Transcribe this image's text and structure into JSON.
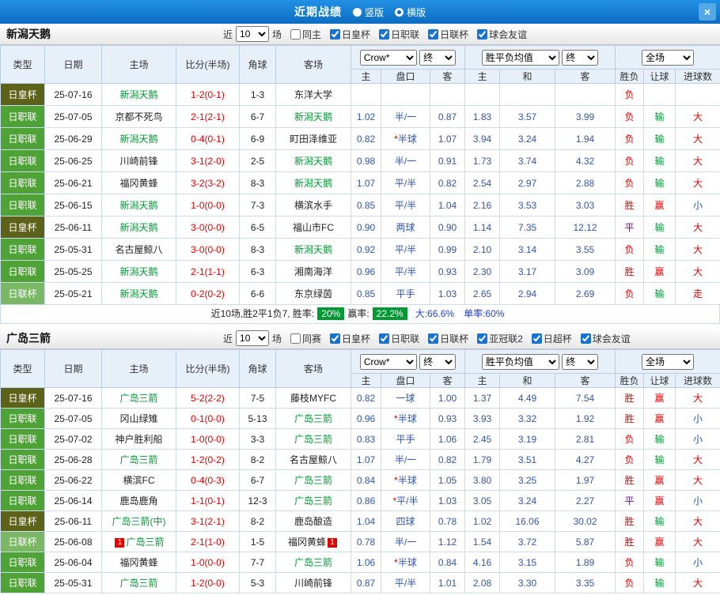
{
  "topbar": {
    "title": "近期战绩",
    "radios": [
      {
        "label": "竖版",
        "checked": false
      },
      {
        "label": "横版",
        "checked": true
      }
    ],
    "close_icon": "×"
  },
  "filter_common": {
    "near": "近",
    "count": "10",
    "games": "场"
  },
  "table_head": {
    "type": "类型",
    "date": "日期",
    "home": "主场",
    "score": "比分(半场)",
    "corner": "角球",
    "away": "客场",
    "company": "Crow*",
    "final": "终",
    "avg": "胜平负均值",
    "scope": "全场",
    "h": "主",
    "handicap": "盘口",
    "a": "客",
    "draw": "和",
    "result": "胜负",
    "let": "让球",
    "goals": "进球数"
  },
  "colors": {
    "topbar_blue": "#0c6cc1",
    "win_red": "#e60000",
    "lose_green": "#009933",
    "small_blue": "#1f4fd8",
    "draw_purple": "#8000a0",
    "odds_blue": "#3355aa",
    "focal_team_green": "#009933",
    "type_emperor_cup_bg": "#5c6319",
    "type_j1_league_bg": "#4fa236",
    "type_league_cup_bg": "#7ab865",
    "rate_badge_green": "#009933"
  },
  "sections": [
    {
      "team": "新潟天鹅",
      "filters": [
        {
          "label": "同主",
          "checked": false
        },
        {
          "label": "日皇杯",
          "checked": true
        },
        {
          "label": "日职联",
          "checked": true
        },
        {
          "label": "日联杯",
          "checked": true
        },
        {
          "label": "球会友谊",
          "checked": true
        }
      ],
      "rows": [
        {
          "type": "日皇杯",
          "tk": "cup",
          "date": "25-07-16",
          "home": "新潟天鹅",
          "hf": true,
          "score": "1-2(0-1)",
          "corner": "1-3",
          "away": "东洋大学",
          "af": false,
          "odds": [
            "",
            "",
            "",
            "",
            "",
            ""
          ],
          "star": false,
          "res": [
            [
              "负",
              "r"
            ],
            [
              "",
              ""
            ],
            [
              "",
              ""
            ]
          ]
        },
        {
          "type": "日职联",
          "tk": "lg",
          "date": "25-07-05",
          "home": "京都不死鸟",
          "hf": false,
          "score": "2-1(2-1)",
          "corner": "6-7",
          "away": "新潟天鹅",
          "af": true,
          "odds": [
            "1.02",
            "半/一",
            "0.87",
            "1.83",
            "3.57",
            "3.99"
          ],
          "star": false,
          "res": [
            [
              "负",
              "r"
            ],
            [
              "输",
              "g"
            ],
            [
              "大",
              "r"
            ]
          ]
        },
        {
          "type": "日职联",
          "tk": "lg",
          "date": "25-06-29",
          "home": "新潟天鹅",
          "hf": true,
          "score": "0-4(0-1)",
          "corner": "6-9",
          "away": "町田泽维亚",
          "af": false,
          "odds": [
            "0.82",
            "半球",
            "1.07",
            "3.94",
            "3.24",
            "1.94"
          ],
          "star": true,
          "res": [
            [
              "负",
              "r"
            ],
            [
              "输",
              "g"
            ],
            [
              "大",
              "r"
            ]
          ]
        },
        {
          "type": "日职联",
          "tk": "lg",
          "date": "25-06-25",
          "home": "川崎前锋",
          "hf": false,
          "score": "3-1(2-0)",
          "corner": "2-5",
          "away": "新潟天鹅",
          "af": true,
          "odds": [
            "0.98",
            "半/一",
            "0.91",
            "1.73",
            "3.74",
            "4.32"
          ],
          "star": false,
          "res": [
            [
              "负",
              "r"
            ],
            [
              "输",
              "g"
            ],
            [
              "大",
              "r"
            ]
          ]
        },
        {
          "type": "日职联",
          "tk": "lg",
          "date": "25-06-21",
          "home": "福冈黄蜂",
          "hf": false,
          "score": "3-2(3-2)",
          "corner": "8-3",
          "away": "新潟天鹅",
          "af": true,
          "odds": [
            "1.07",
            "平/半",
            "0.82",
            "2.54",
            "2.97",
            "2.88"
          ],
          "star": false,
          "res": [
            [
              "负",
              "r"
            ],
            [
              "输",
              "g"
            ],
            [
              "大",
              "r"
            ]
          ]
        },
        {
          "type": "日职联",
          "tk": "lg",
          "date": "25-06-15",
          "home": "新潟天鹅",
          "hf": true,
          "score": "1-0(0-0)",
          "corner": "7-3",
          "away": "横滨水手",
          "af": false,
          "odds": [
            "0.85",
            "平/半",
            "1.04",
            "2.16",
            "3.53",
            "3.03"
          ],
          "star": false,
          "res": [
            [
              "胜",
              "r"
            ],
            [
              "赢",
              "r"
            ],
            [
              "小",
              "b"
            ]
          ]
        },
        {
          "type": "日皇杯",
          "tk": "cup",
          "date": "25-06-11",
          "home": "新潟天鹅",
          "hf": true,
          "score": "3-0(0-0)",
          "corner": "6-5",
          "away": "福山市FC",
          "af": false,
          "odds": [
            "0.90",
            "两球",
            "0.90",
            "1.14",
            "7.35",
            "12.12"
          ],
          "star": false,
          "res": [
            [
              "平",
              "p"
            ],
            [
              "输",
              "g"
            ],
            [
              "大",
              "r"
            ]
          ]
        },
        {
          "type": "日职联",
          "tk": "lg",
          "date": "25-05-31",
          "home": "名古屋鲸八",
          "hf": false,
          "score": "3-0(0-0)",
          "corner": "8-3",
          "away": "新潟天鹅",
          "af": true,
          "odds": [
            "0.92",
            "平/半",
            "0.99",
            "2.10",
            "3.14",
            "3.55"
          ],
          "star": false,
          "res": [
            [
              "负",
              "r"
            ],
            [
              "输",
              "g"
            ],
            [
              "大",
              "r"
            ]
          ]
        },
        {
          "type": "日职联",
          "tk": "lg",
          "date": "25-05-25",
          "home": "新潟天鹅",
          "hf": true,
          "score": "2-1(1-1)",
          "corner": "6-3",
          "away": "湘南海洋",
          "af": false,
          "odds": [
            "0.96",
            "平/半",
            "0.93",
            "2.30",
            "3.17",
            "3.09"
          ],
          "star": false,
          "res": [
            [
              "胜",
              "r"
            ],
            [
              "赢",
              "r"
            ],
            [
              "大",
              "r"
            ]
          ]
        },
        {
          "type": "日联杯",
          "tk": "lc",
          "date": "25-05-21",
          "home": "新潟天鹅",
          "hf": true,
          "score": "0-2(0-2)",
          "corner": "6-6",
          "away": "东京绿茵",
          "af": false,
          "odds": [
            "0.85",
            "平手",
            "1.03",
            "2.65",
            "2.94",
            "2.69"
          ],
          "star": false,
          "res": [
            [
              "负",
              "r"
            ],
            [
              "输",
              "g"
            ],
            [
              "走",
              "r"
            ]
          ]
        }
      ],
      "summary": {
        "prefix": "近10场,胜2平1负7, 胜率:",
        "win_rate": "20%",
        "profit_label": "赢率:",
        "profit_rate": "22.2%",
        "big_rate": "大:66.6%",
        "single_rate": "单率:60%"
      }
    },
    {
      "team": "广岛三箭",
      "filters": [
        {
          "label": "同赛",
          "checked": false
        },
        {
          "label": "日皇杯",
          "checked": true
        },
        {
          "label": "日职联",
          "checked": true
        },
        {
          "label": "日联杯",
          "checked": true
        },
        {
          "label": "亚冠联2",
          "checked": true
        },
        {
          "label": "日超杯",
          "checked": true
        },
        {
          "label": "球会友谊",
          "checked": true
        }
      ],
      "rows": [
        {
          "type": "日皇杯",
          "tk": "cup",
          "date": "25-07-16",
          "home": "广岛三箭",
          "hf": true,
          "score": "5-2(2-2)",
          "corner": "7-5",
          "away": "藤枝MYFC",
          "af": false,
          "odds": [
            "0.82",
            "一球",
            "1.00",
            "1.37",
            "4.49",
            "7.54"
          ],
          "star": false,
          "res": [
            [
              "胜",
              "r"
            ],
            [
              "赢",
              "r"
            ],
            [
              "大",
              "r"
            ]
          ]
        },
        {
          "type": "日职联",
          "tk": "lg",
          "date": "25-07-05",
          "home": "冈山绿雉",
          "hf": false,
          "score": "0-1(0-0)",
          "corner": "5-13",
          "away": "广岛三箭",
          "af": true,
          "odds": [
            "0.96",
            "半球",
            "0.93",
            "3.93",
            "3.32",
            "1.92"
          ],
          "star": true,
          "res": [
            [
              "胜",
              "r"
            ],
            [
              "赢",
              "r"
            ],
            [
              "小",
              "b"
            ]
          ]
        },
        {
          "type": "日职联",
          "tk": "lg",
          "date": "25-07-02",
          "home": "神户胜利船",
          "hf": false,
          "score": "1-0(0-0)",
          "corner": "3-3",
          "away": "广岛三箭",
          "af": true,
          "odds": [
            "0.83",
            "平手",
            "1.06",
            "2.45",
            "3.19",
            "2.81"
          ],
          "star": false,
          "res": [
            [
              "负",
              "r"
            ],
            [
              "输",
              "g"
            ],
            [
              "小",
              "b"
            ]
          ]
        },
        {
          "type": "日职联",
          "tk": "lg",
          "date": "25-06-28",
          "home": "广岛三箭",
          "hf": true,
          "score": "1-2(0-2)",
          "corner": "8-2",
          "away": "名古屋鲸八",
          "af": false,
          "odds": [
            "1.07",
            "半/一",
            "0.82",
            "1.79",
            "3.51",
            "4.27"
          ],
          "star": false,
          "res": [
            [
              "负",
              "r"
            ],
            [
              "输",
              "g"
            ],
            [
              "大",
              "r"
            ]
          ]
        },
        {
          "type": "日职联",
          "tk": "lg",
          "date": "25-06-22",
          "home": "横滨FC",
          "hf": false,
          "score": "0-4(0-3)",
          "corner": "6-7",
          "away": "广岛三箭",
          "af": true,
          "odds": [
            "0.84",
            "半球",
            "1.05",
            "3.80",
            "3.25",
            "1.97"
          ],
          "star": true,
          "res": [
            [
              "胜",
              "r"
            ],
            [
              "赢",
              "r"
            ],
            [
              "大",
              "r"
            ]
          ]
        },
        {
          "type": "日职联",
          "tk": "lg",
          "date": "25-06-14",
          "home": "鹿岛鹿角",
          "hf": false,
          "score": "1-1(0-1)",
          "corner": "12-3",
          "away": "广岛三箭",
          "af": true,
          "odds": [
            "0.86",
            "平/半",
            "1.03",
            "3.05",
            "3.24",
            "2.27"
          ],
          "star": true,
          "res": [
            [
              "平",
              "p"
            ],
            [
              "赢",
              "r"
            ],
            [
              "小",
              "b"
            ]
          ]
        },
        {
          "type": "日皇杯",
          "tk": "cup",
          "date": "25-06-11",
          "home": "广岛三箭(中)",
          "hf": true,
          "score": "3-1(2-1)",
          "corner": "8-2",
          "away": "鹿岛酿造",
          "af": false,
          "odds": [
            "1.04",
            "四球",
            "0.78",
            "1.02",
            "16.06",
            "30.02"
          ],
          "star": false,
          "res": [
            [
              "胜",
              "r"
            ],
            [
              "输",
              "g"
            ],
            [
              "大",
              "r"
            ]
          ]
        },
        {
          "type": "日联杯",
          "tk": "lc",
          "date": "25-06-08",
          "home": "广岛三箭",
          "hf": true,
          "hb": "1",
          "score": "2-1(1-0)",
          "corner": "1-5",
          "away": "福冈黄蜂",
          "af": false,
          "ab": "1",
          "odds": [
            "0.78",
            "半/一",
            "1.12",
            "1.54",
            "3.72",
            "5.87"
          ],
          "star": false,
          "res": [
            [
              "胜",
              "r"
            ],
            [
              "赢",
              "r"
            ],
            [
              "大",
              "r"
            ]
          ]
        },
        {
          "type": "日职联",
          "tk": "lg",
          "date": "25-06-04",
          "home": "福冈黄蜂",
          "hf": false,
          "score": "1-0(0-0)",
          "corner": "7-7",
          "away": "广岛三箭",
          "af": true,
          "odds": [
            "1.06",
            "半球",
            "0.84",
            "4.16",
            "3.15",
            "1.89"
          ],
          "star": true,
          "res": [
            [
              "负",
              "r"
            ],
            [
              "输",
              "g"
            ],
            [
              "小",
              "b"
            ]
          ]
        },
        {
          "type": "日职联",
          "tk": "lg",
          "date": "25-05-31",
          "home": "广岛三箭",
          "hf": true,
          "score": "1-2(0-0)",
          "corner": "5-3",
          "away": "川崎前锋",
          "af": false,
          "odds": [
            "0.87",
            "平/半",
            "1.01",
            "2.08",
            "3.30",
            "3.35"
          ],
          "star": false,
          "res": [
            [
              "负",
              "r"
            ],
            [
              "输",
              "g"
            ],
            [
              "大",
              "r"
            ]
          ]
        }
      ],
      "summary": null
    }
  ]
}
